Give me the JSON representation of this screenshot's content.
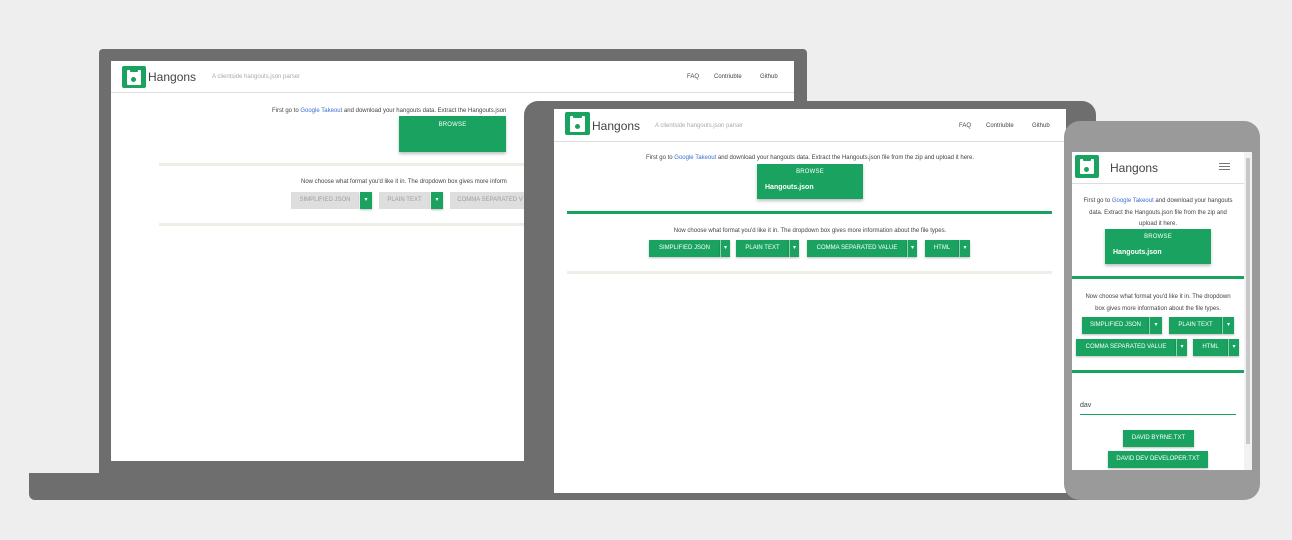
{
  "app": {
    "brand": "Hangons",
    "tagline": "A clientside hangouts.json parser",
    "nav": [
      "FAQ",
      "Contriubte",
      "Github"
    ]
  },
  "intro": {
    "prefix": "First go to ",
    "link": "Google Takeout",
    "suffix": " and download your hangouts data. Extract the Hangouts.json file from the zip and upload it here.",
    "laptop_suffix_truncated": " and download your hangouts data. Extract the Hangouts.json"
  },
  "browse": {
    "label": "BROWSE",
    "file": "Hangouts.json"
  },
  "formats": {
    "prompt": "Now choose what format you'd like it in. The dropdown box gives more information about the file types.",
    "laptop_prompt_truncated": "Now choose what format you'd like it in. The dropdown box gives more inform",
    "options": [
      "SIMPLIFIED JSON",
      "PLAIN TEXT",
      "COMMA SEPARATED VALUE",
      "HTML"
    ],
    "laptop_csv_truncated": "COMMA SEPARATED V",
    "caret": "▾"
  },
  "phone": {
    "intro_line1": "First go to",
    "intro_line2": "download your hangouts",
    "intro_line3": "data. Extract the Hangouts.json file from the zip and",
    "intro_line4": "upload it here.",
    "prompt_line1": "Now choose what format you'd like it in. The dropdown",
    "prompt_line2": "box gives more information about the file types.",
    "search_value": "dav",
    "results": [
      "DAVID BYRNE.TXT",
      "DAVID DEV DEVELOPER.TXT"
    ],
    "menu_icon": "hamburger-icon"
  },
  "colors": {
    "accent": "#1aa260",
    "link": "#3b6fd6",
    "device": "#6e6e6e",
    "background": "#eeeeee"
  }
}
